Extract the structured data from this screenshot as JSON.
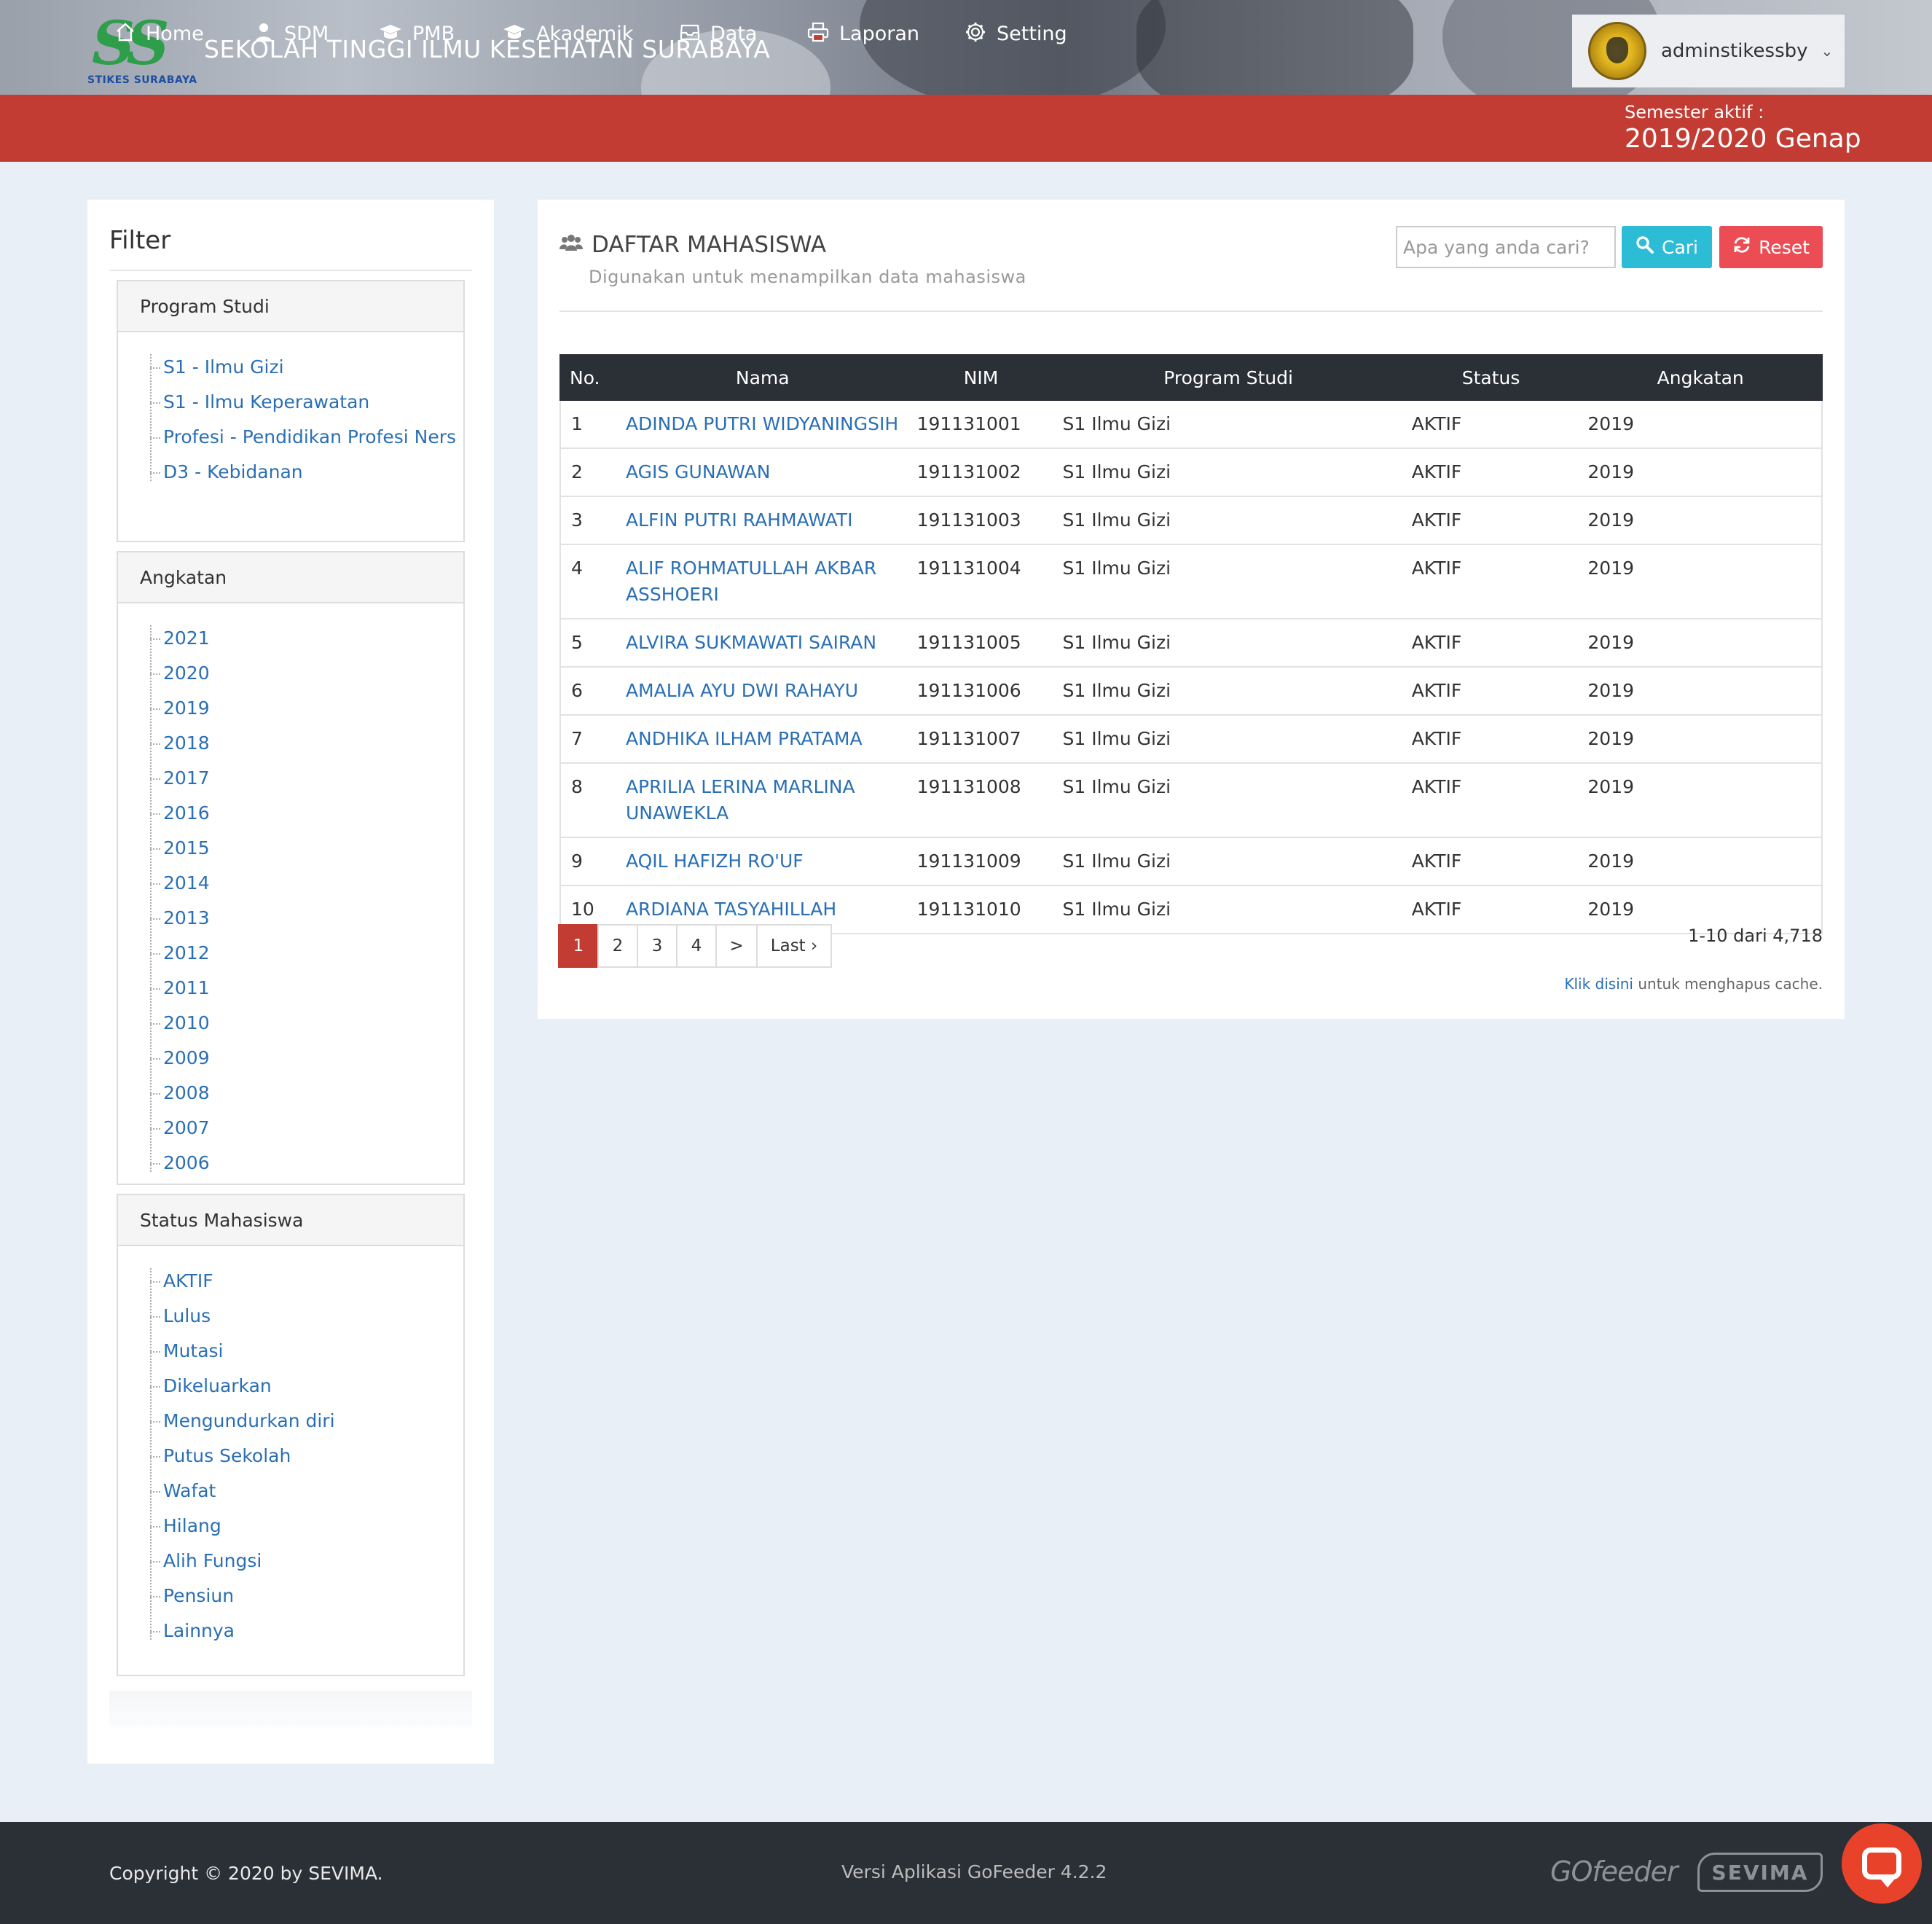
{
  "header": {
    "logo_text": "STIKES SURABAYA",
    "school_name": "SEKOLAH TINGGI ILMU KESEHATAN SURABAYA",
    "username": "adminstikessby",
    "user_menu_icon": "chevron-down-icon"
  },
  "nav": {
    "items": [
      {
        "label": "Home",
        "icon": "home-icon"
      },
      {
        "label": "SDM",
        "icon": "user-icon"
      },
      {
        "label": "PMB",
        "icon": "graduation-cap-icon"
      },
      {
        "label": "Akademik",
        "icon": "graduation-cap-icon"
      },
      {
        "label": "Data",
        "icon": "inbox-icon"
      },
      {
        "label": "Laporan",
        "icon": "printer-icon"
      },
      {
        "label": "Setting",
        "icon": "gear-icon"
      }
    ],
    "semester_label": "Semester aktif :",
    "semester_value": "2019/2020 Genap"
  },
  "sidebar": {
    "title": "Filter",
    "program_studi": {
      "heading": "Program Studi",
      "items": [
        "S1 - Ilmu Gizi",
        "S1 - Ilmu Keperawatan",
        "Profesi - Pendidikan Profesi Ners",
        "D3 - Kebidanan"
      ]
    },
    "angkatan": {
      "heading": "Angkatan",
      "items": [
        "2021",
        "2020",
        "2019",
        "2018",
        "2017",
        "2016",
        "2015",
        "2014",
        "2013",
        "2012",
        "2011",
        "2010",
        "2009",
        "2008",
        "2007",
        "2006"
      ]
    },
    "status": {
      "heading": "Status Mahasiswa",
      "items": [
        "AKTIF",
        "Lulus",
        "Mutasi",
        "Dikeluarkan",
        "Mengundurkan diri",
        "Putus Sekolah",
        "Wafat",
        "Hilang",
        "Alih Fungsi",
        "Pensiun",
        "Lainnya"
      ]
    }
  },
  "main": {
    "title": "DAFTAR MAHASISWA",
    "title_icon": "users-icon",
    "subtitle": "Digunakan untuk menampilkan data mahasiswa",
    "search_placeholder": "Apa yang anda cari?",
    "search_value": "",
    "cari_label": "Cari",
    "reset_label": "Reset",
    "table": {
      "columns": [
        "No.",
        "Nama",
        "NIM",
        "Program Studi",
        "Status",
        "Angkatan"
      ],
      "rows": [
        [
          "1",
          "ADINDA PUTRI WIDYANINGSIH",
          "191131001",
          "S1 Ilmu Gizi",
          "AKTIF",
          "2019"
        ],
        [
          "2",
          "AGIS GUNAWAN",
          "191131002",
          "S1 Ilmu Gizi",
          "AKTIF",
          "2019"
        ],
        [
          "3",
          "ALFIN PUTRI RAHMAWATI",
          "191131003",
          "S1 Ilmu Gizi",
          "AKTIF",
          "2019"
        ],
        [
          "4",
          "ALIF ROHMATULLAH AKBAR ASSHOERI",
          "191131004",
          "S1 Ilmu Gizi",
          "AKTIF",
          "2019"
        ],
        [
          "5",
          "ALVIRA SUKMAWATI SAIRAN",
          "191131005",
          "S1 Ilmu Gizi",
          "AKTIF",
          "2019"
        ],
        [
          "6",
          "AMALIA AYU DWI RAHAYU",
          "191131006",
          "S1 Ilmu Gizi",
          "AKTIF",
          "2019"
        ],
        [
          "7",
          "ANDHIKA ILHAM PRATAMA",
          "191131007",
          "S1 Ilmu Gizi",
          "AKTIF",
          "2019"
        ],
        [
          "8",
          "APRILIA LERINA MARLINA UNAWEKLA",
          "191131008",
          "S1 Ilmu Gizi",
          "AKTIF",
          "2019"
        ],
        [
          "9",
          "AQIL HAFIZH RO'UF",
          "191131009",
          "S1 Ilmu Gizi",
          "AKTIF",
          "2019"
        ],
        [
          "10",
          "ARDIANA TASYAHILLAH",
          "191131010",
          "S1 Ilmu Gizi",
          "AKTIF",
          "2019"
        ]
      ]
    },
    "pagination": [
      "1",
      "2",
      "3",
      "4",
      ">",
      "Last ›"
    ],
    "pagination_active": "1",
    "count_text": "1-10 dari 4,718",
    "cache_link": "Klik disini",
    "cache_text": "untuk menghapus cache."
  },
  "footer": {
    "copyright": "Copyright © 2020 by SEVIMA.",
    "version": "Versi Aplikasi GoFeeder 4.2.2",
    "brand_gofeeder": "GOfeeder",
    "brand_sevima": "SEVIMA",
    "chat_icon": "chat-icon"
  },
  "colors": {
    "nav_red": "#c33c33",
    "link_blue": "#2a6fb5",
    "cari_cyan": "#2cbcd6",
    "reset_red": "#ec4d55",
    "table_header": "#2b2f36",
    "footer_bg": "#2b2f36",
    "chat_orange": "#e8432a"
  }
}
